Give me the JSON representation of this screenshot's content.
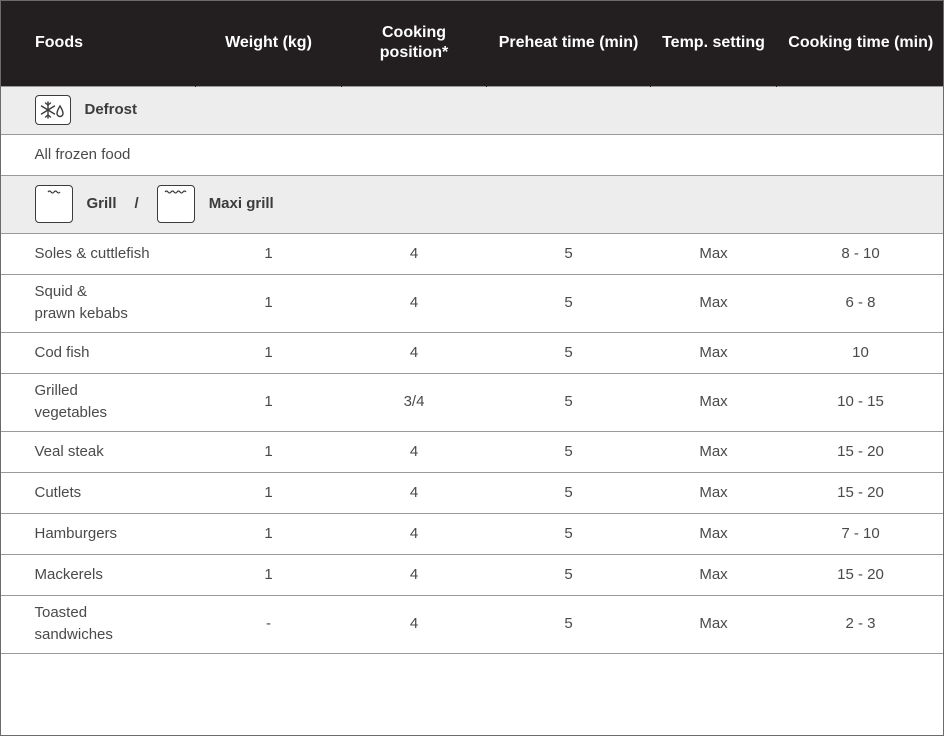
{
  "headers": {
    "foods": "Foods",
    "weight": "Weight (kg)",
    "position": "Cooking position*",
    "preheat": "Preheat time (min)",
    "temp": "Temp. setting",
    "time": "Cooking time (min)"
  },
  "defrost": {
    "label": "Defrost",
    "icon": "defrost-icon",
    "row_food": "All frozen food"
  },
  "grill": {
    "label": "Grill",
    "separator": "/",
    "maxi_label": "Maxi grill",
    "icon": "grill-icon",
    "maxi_icon": "maxi-grill-icon"
  },
  "rows": [
    {
      "food": "Soles & cuttlefish",
      "weight": "1",
      "position": "4",
      "preheat": "5",
      "temp": "Max",
      "time": "8 - 10"
    },
    {
      "food": "Squid & prawn kebabs",
      "weight": "1",
      "position": "4",
      "preheat": "5",
      "temp": "Max",
      "time": "6 - 8"
    },
    {
      "food": "Cod fish",
      "weight": "1",
      "position": "4",
      "preheat": "5",
      "temp": "Max",
      "time": "10"
    },
    {
      "food": "Grilled vegetables",
      "weight": "1",
      "position": "3/4",
      "preheat": "5",
      "temp": "Max",
      "time": "10 - 15"
    },
    {
      "food": "Veal steak",
      "weight": "1",
      "position": "4",
      "preheat": "5",
      "temp": "Max",
      "time": "15 - 20"
    },
    {
      "food": "Cutlets",
      "weight": "1",
      "position": "4",
      "preheat": "5",
      "temp": "Max",
      "time": "15 - 20"
    },
    {
      "food": "Hamburgers",
      "weight": "1",
      "position": "4",
      "preheat": "5",
      "temp": "Max",
      "time": "7 - 10"
    },
    {
      "food": "Mackerels",
      "weight": "1",
      "position": "4",
      "preheat": "5",
      "temp": "Max",
      "time": "15 - 20"
    },
    {
      "food": "Toasted sandwiches",
      "weight": "-",
      "position": "4",
      "preheat": "5",
      "temp": "Max",
      "time": "2 - 3"
    }
  ]
}
